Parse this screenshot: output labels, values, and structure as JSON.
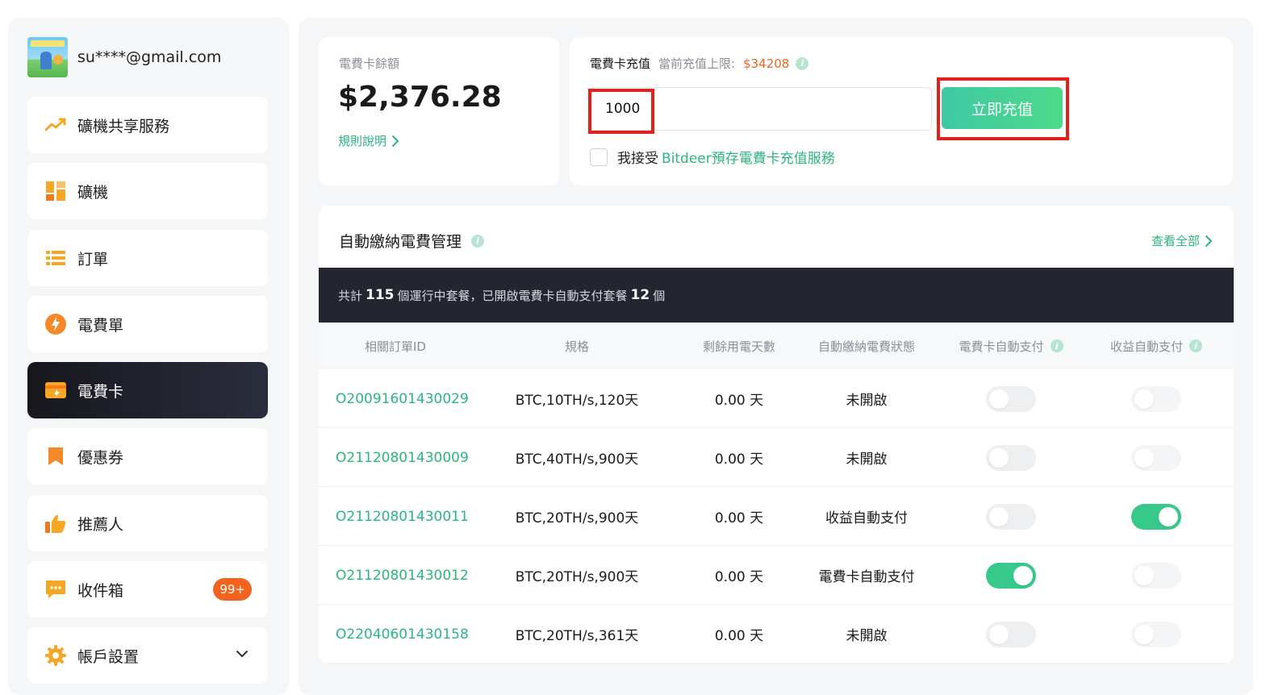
{
  "user": {
    "email": "su****@gmail.com"
  },
  "sidebar": {
    "items": [
      {
        "label": "礦機共享服務",
        "icon": "trend-up-icon"
      },
      {
        "label": "礦機",
        "icon": "grid-blocks-icon"
      },
      {
        "label": "訂單",
        "icon": "list-icon"
      },
      {
        "label": "電費單",
        "icon": "lightning-icon"
      },
      {
        "label": "電費卡",
        "icon": "card-icon",
        "active": true
      },
      {
        "label": "優惠券",
        "icon": "bookmark-icon"
      },
      {
        "label": "推薦人",
        "icon": "thumbs-up-icon"
      },
      {
        "label": "收件箱",
        "icon": "message-icon",
        "badge": "99+"
      },
      {
        "label": "帳戶設置",
        "icon": "gear-icon"
      }
    ]
  },
  "balance": {
    "label": "電費卡餘額",
    "value": "$2,376.28",
    "rules_link": "規則說明"
  },
  "topup": {
    "title": "電費卡充值",
    "limit_label": "當前充值上限:",
    "limit_value": "$34208",
    "amount": "1000",
    "button": "立即充值",
    "agree_prefix": "我接受",
    "agree_link": "Bitdeer預存電費卡充值服務"
  },
  "auto": {
    "title": "自動繳納電費管理",
    "view_all": "查看全部",
    "summary": {
      "p1": "共計",
      "running": "115",
      "p2": "個運行中套餐，已開啟電費卡自動支付套餐",
      "enabled": "12",
      "p3": "個"
    },
    "columns": [
      "相關訂單ID",
      "規格",
      "剩餘用電天數",
      "自動繳納電費狀態",
      "電費卡自動支付",
      "收益自動支付"
    ],
    "rows": [
      {
        "id": "O20091601430029",
        "spec": "BTC,10TH/s,120天",
        "days": "0.00 天",
        "status": "未開啟",
        "card_auto": false,
        "income_auto": false
      },
      {
        "id": "O21120801430009",
        "spec": "BTC,40TH/s,900天",
        "days": "0.00 天",
        "status": "未開啟",
        "card_auto": false,
        "income_auto": false
      },
      {
        "id": "O21120801430011",
        "spec": "BTC,20TH/s,900天",
        "days": "0.00 天",
        "status": "收益自動支付",
        "card_auto": false,
        "income_auto": true
      },
      {
        "id": "O21120801430012",
        "spec": "BTC,20TH/s,900天",
        "days": "0.00 天",
        "status": "電費卡自動支付",
        "card_auto": true,
        "income_auto": false
      },
      {
        "id": "O22040601430158",
        "spec": "BTC,20TH/s,361天",
        "days": "0.00 天",
        "status": "未開啟",
        "card_auto": false,
        "income_auto": false
      }
    ]
  },
  "colors": {
    "accent_green": "#2cb67d",
    "orange": "#f0641e",
    "highlight_red": "#e3211c",
    "dark": "#23252f"
  }
}
